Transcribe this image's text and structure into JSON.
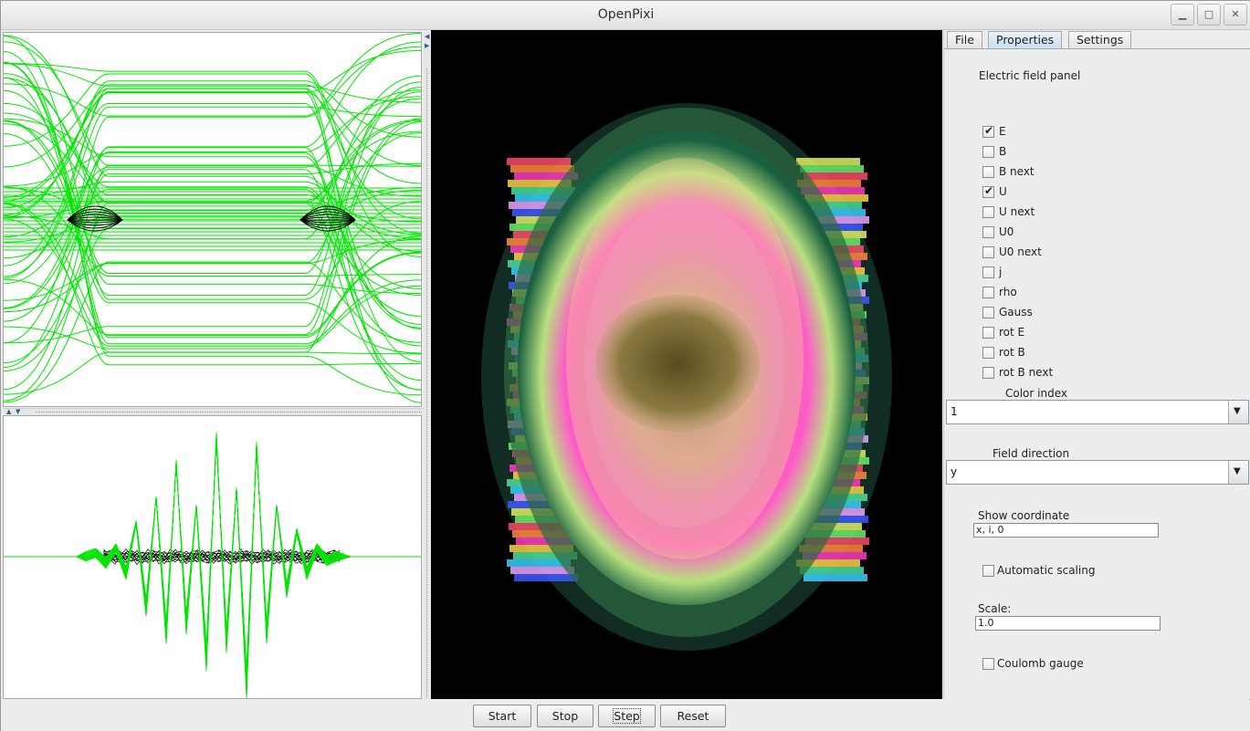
{
  "window": {
    "title": "OpenPixi"
  },
  "tabs": [
    {
      "label": "File"
    },
    {
      "label": "Properties"
    },
    {
      "label": "Settings"
    }
  ],
  "properties": {
    "heading": "Electric field panel",
    "checkboxes": [
      {
        "label": "E",
        "checked": true
      },
      {
        "label": "B",
        "checked": false
      },
      {
        "label": "B next",
        "checked": false
      },
      {
        "label": "U",
        "checked": true
      },
      {
        "label": "U next",
        "checked": false
      },
      {
        "label": "U0",
        "checked": false
      },
      {
        "label": "U0 next",
        "checked": false
      },
      {
        "label": "j",
        "checked": false
      },
      {
        "label": "rho",
        "checked": false
      },
      {
        "label": "Gauss",
        "checked": false
      },
      {
        "label": "rot E",
        "checked": false
      },
      {
        "label": "rot B",
        "checked": false
      },
      {
        "label": "rot B next",
        "checked": false
      }
    ],
    "color_index": {
      "label": "Color index",
      "value": "1"
    },
    "field_direction": {
      "label": "Field direction",
      "value": "y"
    },
    "show_coordinate": {
      "label": "Show coordinate",
      "value": "x, i, 0"
    },
    "automatic_scaling": {
      "label": "Automatic scaling",
      "checked": false
    },
    "scale": {
      "label": "Scale:",
      "value": "1.0"
    },
    "coulomb_gauge": {
      "label": "Coulomb gauge",
      "checked": false
    }
  },
  "controls": {
    "start": "Start",
    "stop": "Stop",
    "step": "Step",
    "reset": "Reset"
  },
  "icons": {
    "minimize": "minimize-icon",
    "maximize": "maximize-icon",
    "close": "close-icon",
    "dropdown": "chevron-down-icon"
  },
  "colors": {
    "trace_green": "#00e600",
    "trace_black": "#000000",
    "tab_active": "#c9dcf0",
    "field_bg": "#000000"
  }
}
